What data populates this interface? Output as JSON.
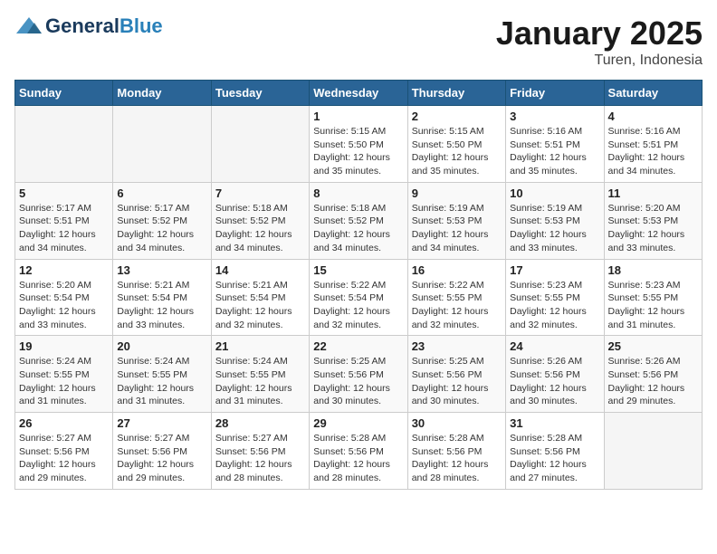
{
  "header": {
    "logo_general": "General",
    "logo_blue": "Blue",
    "month": "January 2025",
    "location": "Turen, Indonesia"
  },
  "weekdays": [
    "Sunday",
    "Monday",
    "Tuesday",
    "Wednesday",
    "Thursday",
    "Friday",
    "Saturday"
  ],
  "weeks": [
    [
      {
        "day": "",
        "info": ""
      },
      {
        "day": "",
        "info": ""
      },
      {
        "day": "",
        "info": ""
      },
      {
        "day": "1",
        "info": "Sunrise: 5:15 AM\nSunset: 5:50 PM\nDaylight: 12 hours\nand 35 minutes."
      },
      {
        "day": "2",
        "info": "Sunrise: 5:15 AM\nSunset: 5:50 PM\nDaylight: 12 hours\nand 35 minutes."
      },
      {
        "day": "3",
        "info": "Sunrise: 5:16 AM\nSunset: 5:51 PM\nDaylight: 12 hours\nand 35 minutes."
      },
      {
        "day": "4",
        "info": "Sunrise: 5:16 AM\nSunset: 5:51 PM\nDaylight: 12 hours\nand 34 minutes."
      }
    ],
    [
      {
        "day": "5",
        "info": "Sunrise: 5:17 AM\nSunset: 5:51 PM\nDaylight: 12 hours\nand 34 minutes."
      },
      {
        "day": "6",
        "info": "Sunrise: 5:17 AM\nSunset: 5:52 PM\nDaylight: 12 hours\nand 34 minutes."
      },
      {
        "day": "7",
        "info": "Sunrise: 5:18 AM\nSunset: 5:52 PM\nDaylight: 12 hours\nand 34 minutes."
      },
      {
        "day": "8",
        "info": "Sunrise: 5:18 AM\nSunset: 5:52 PM\nDaylight: 12 hours\nand 34 minutes."
      },
      {
        "day": "9",
        "info": "Sunrise: 5:19 AM\nSunset: 5:53 PM\nDaylight: 12 hours\nand 34 minutes."
      },
      {
        "day": "10",
        "info": "Sunrise: 5:19 AM\nSunset: 5:53 PM\nDaylight: 12 hours\nand 33 minutes."
      },
      {
        "day": "11",
        "info": "Sunrise: 5:20 AM\nSunset: 5:53 PM\nDaylight: 12 hours\nand 33 minutes."
      }
    ],
    [
      {
        "day": "12",
        "info": "Sunrise: 5:20 AM\nSunset: 5:54 PM\nDaylight: 12 hours\nand 33 minutes."
      },
      {
        "day": "13",
        "info": "Sunrise: 5:21 AM\nSunset: 5:54 PM\nDaylight: 12 hours\nand 33 minutes."
      },
      {
        "day": "14",
        "info": "Sunrise: 5:21 AM\nSunset: 5:54 PM\nDaylight: 12 hours\nand 32 minutes."
      },
      {
        "day": "15",
        "info": "Sunrise: 5:22 AM\nSunset: 5:54 PM\nDaylight: 12 hours\nand 32 minutes."
      },
      {
        "day": "16",
        "info": "Sunrise: 5:22 AM\nSunset: 5:55 PM\nDaylight: 12 hours\nand 32 minutes."
      },
      {
        "day": "17",
        "info": "Sunrise: 5:23 AM\nSunset: 5:55 PM\nDaylight: 12 hours\nand 32 minutes."
      },
      {
        "day": "18",
        "info": "Sunrise: 5:23 AM\nSunset: 5:55 PM\nDaylight: 12 hours\nand 31 minutes."
      }
    ],
    [
      {
        "day": "19",
        "info": "Sunrise: 5:24 AM\nSunset: 5:55 PM\nDaylight: 12 hours\nand 31 minutes."
      },
      {
        "day": "20",
        "info": "Sunrise: 5:24 AM\nSunset: 5:55 PM\nDaylight: 12 hours\nand 31 minutes."
      },
      {
        "day": "21",
        "info": "Sunrise: 5:24 AM\nSunset: 5:55 PM\nDaylight: 12 hours\nand 31 minutes."
      },
      {
        "day": "22",
        "info": "Sunrise: 5:25 AM\nSunset: 5:56 PM\nDaylight: 12 hours\nand 30 minutes."
      },
      {
        "day": "23",
        "info": "Sunrise: 5:25 AM\nSunset: 5:56 PM\nDaylight: 12 hours\nand 30 minutes."
      },
      {
        "day": "24",
        "info": "Sunrise: 5:26 AM\nSunset: 5:56 PM\nDaylight: 12 hours\nand 30 minutes."
      },
      {
        "day": "25",
        "info": "Sunrise: 5:26 AM\nSunset: 5:56 PM\nDaylight: 12 hours\nand 29 minutes."
      }
    ],
    [
      {
        "day": "26",
        "info": "Sunrise: 5:27 AM\nSunset: 5:56 PM\nDaylight: 12 hours\nand 29 minutes."
      },
      {
        "day": "27",
        "info": "Sunrise: 5:27 AM\nSunset: 5:56 PM\nDaylight: 12 hours\nand 29 minutes."
      },
      {
        "day": "28",
        "info": "Sunrise: 5:27 AM\nSunset: 5:56 PM\nDaylight: 12 hours\nand 28 minutes."
      },
      {
        "day": "29",
        "info": "Sunrise: 5:28 AM\nSunset: 5:56 PM\nDaylight: 12 hours\nand 28 minutes."
      },
      {
        "day": "30",
        "info": "Sunrise: 5:28 AM\nSunset: 5:56 PM\nDaylight: 12 hours\nand 28 minutes."
      },
      {
        "day": "31",
        "info": "Sunrise: 5:28 AM\nSunset: 5:56 PM\nDaylight: 12 hours\nand 27 minutes."
      },
      {
        "day": "",
        "info": ""
      }
    ]
  ]
}
